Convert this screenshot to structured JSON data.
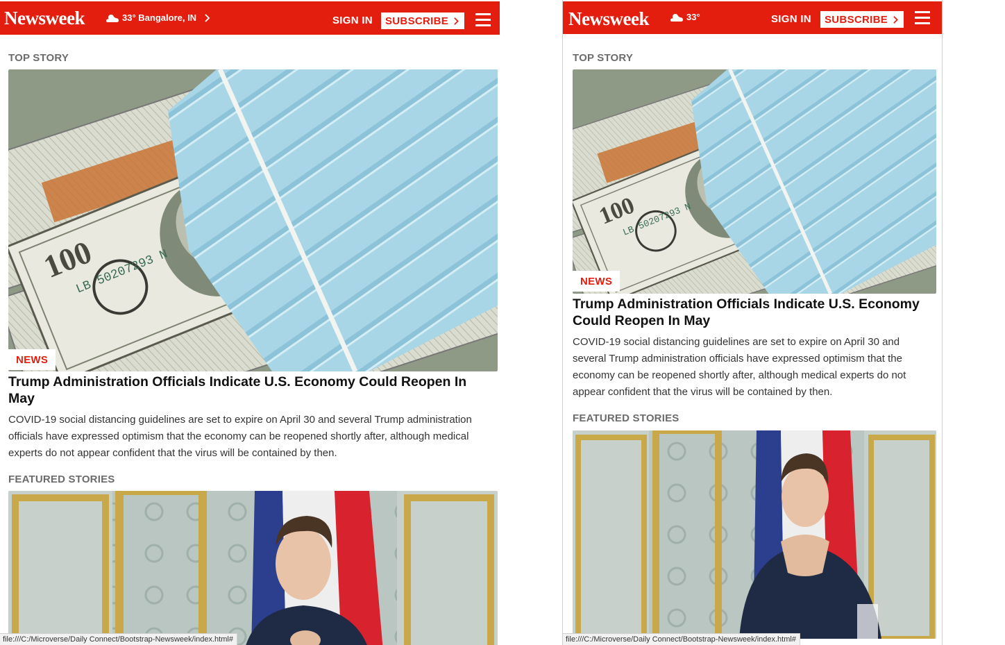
{
  "header": {
    "logo": "Newsweek",
    "weather_left": "33° Bangalore, IN",
    "weather_right": "33°",
    "signin_label": "SIGN IN",
    "subscribe_label": "SUBSCRIBE",
    "brand_color": "#e31e0f"
  },
  "top_story": {
    "section_label": "TOP STORY",
    "badge": "NEWS",
    "headline": "Trump Administration Officials Indicate U.S. Economy Could Reopen In May",
    "summary": "COVID-19 social distancing guidelines are set to expire on April 30 and several Trump administration officials have expressed optimism that the economy can be reopened shortly after, although medical experts do not appear confident that the virus will be contained by then."
  },
  "featured": {
    "section_label": "FEATURED STORIES"
  },
  "statusbar": {
    "url": "file:///C:/Microverse/Daily Connect/Bootstrap-Newsweek/index.html#"
  }
}
